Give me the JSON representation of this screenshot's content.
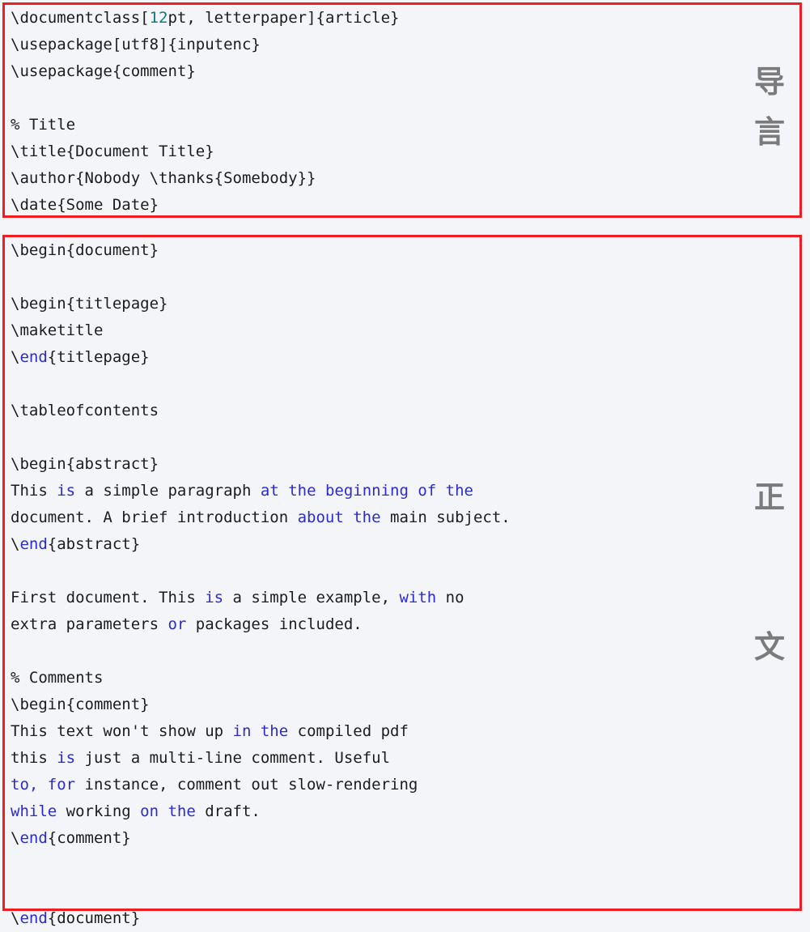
{
  "theme": {
    "background": "#f4f5f8",
    "border_color": "#ee1c23",
    "text_color": "#1c1c1c",
    "keyword_color": "#2b2bd0",
    "number_color": "#0e7b7b",
    "marker_color": "#7b7b7b"
  },
  "preamble_block": {
    "label": "latex-preamble-code-block",
    "markers": [
      {
        "name": "marker-dao",
        "text": "导"
      },
      {
        "name": "marker-yan",
        "text": "言"
      }
    ],
    "lines": [
      [
        {
          "t": "\\documentclass[",
          "k": "plain"
        },
        {
          "t": "12",
          "k": "num"
        },
        {
          "t": "pt, letterpaper]{article}",
          "k": "plain"
        }
      ],
      [
        {
          "t": "\\usepackage[utf8]{inputenc}",
          "k": "plain"
        }
      ],
      [
        {
          "t": "\\usepackage{comment}",
          "k": "plain"
        }
      ],
      [
        {
          "t": "",
          "k": "plain"
        }
      ],
      [
        {
          "t": "% Title",
          "k": "plain"
        }
      ],
      [
        {
          "t": "\\title{Document Title}",
          "k": "plain"
        }
      ],
      [
        {
          "t": "\\author{Nobody \\thanks{Somebody}}",
          "k": "plain"
        }
      ],
      [
        {
          "t": "\\date{Some Date}",
          "k": "plain"
        }
      ]
    ]
  },
  "body_block": {
    "label": "latex-body-code-block",
    "markers": [
      {
        "name": "marker-zheng",
        "text": "正"
      },
      {
        "name": "marker-wen",
        "text": "文"
      }
    ],
    "lines": [
      [
        {
          "t": "\\begin{document}",
          "k": "plain"
        }
      ],
      [
        {
          "t": "",
          "k": "plain"
        }
      ],
      [
        {
          "t": "\\begin{titlepage}",
          "k": "plain"
        }
      ],
      [
        {
          "t": "\\maketitle",
          "k": "plain"
        }
      ],
      [
        {
          "t": "\\",
          "k": "plain"
        },
        {
          "t": "end",
          "k": "kw"
        },
        {
          "t": "{titlepage}",
          "k": "plain"
        }
      ],
      [
        {
          "t": "",
          "k": "plain"
        }
      ],
      [
        {
          "t": "\\tableofcontents",
          "k": "plain"
        }
      ],
      [
        {
          "t": "",
          "k": "plain"
        }
      ],
      [
        {
          "t": "\\begin{abstract}",
          "k": "plain"
        }
      ],
      [
        {
          "t": "This ",
          "k": "plain"
        },
        {
          "t": "is",
          "k": "kw"
        },
        {
          "t": " a simple paragraph ",
          "k": "plain"
        },
        {
          "t": "at the beginning of the",
          "k": "kw"
        }
      ],
      [
        {
          "t": "document. A brief introduction ",
          "k": "plain"
        },
        {
          "t": "about the",
          "k": "kw"
        },
        {
          "t": " main subject.",
          "k": "plain"
        }
      ],
      [
        {
          "t": "\\",
          "k": "plain"
        },
        {
          "t": "end",
          "k": "kw"
        },
        {
          "t": "{abstract}",
          "k": "plain"
        }
      ],
      [
        {
          "t": "",
          "k": "plain"
        }
      ],
      [
        {
          "t": "First document. This ",
          "k": "plain"
        },
        {
          "t": "is",
          "k": "kw"
        },
        {
          "t": " a simple example, ",
          "k": "plain"
        },
        {
          "t": "with",
          "k": "kw"
        },
        {
          "t": " no",
          "k": "plain"
        }
      ],
      [
        {
          "t": "extra parameters ",
          "k": "plain"
        },
        {
          "t": "or",
          "k": "kw"
        },
        {
          "t": " packages included.",
          "k": "plain"
        }
      ],
      [
        {
          "t": "",
          "k": "plain"
        }
      ],
      [
        {
          "t": "% Comments",
          "k": "plain"
        }
      ],
      [
        {
          "t": "\\begin{comment}",
          "k": "plain"
        }
      ],
      [
        {
          "t": "This text won't show up ",
          "k": "plain"
        },
        {
          "t": "in the",
          "k": "kw"
        },
        {
          "t": " compiled pdf",
          "k": "plain"
        }
      ],
      [
        {
          "t": "this ",
          "k": "plain"
        },
        {
          "t": "is",
          "k": "kw"
        },
        {
          "t": " just a multi-line comment. Useful",
          "k": "plain"
        }
      ],
      [
        {
          "t": "to, for",
          "k": "kw"
        },
        {
          "t": " instance, comment out slow-rendering",
          "k": "plain"
        }
      ],
      [
        {
          "t": "while",
          "k": "kw"
        },
        {
          "t": " working ",
          "k": "plain"
        },
        {
          "t": "on the",
          "k": "kw"
        },
        {
          "t": " draft.",
          "k": "plain"
        }
      ],
      [
        {
          "t": "\\",
          "k": "plain"
        },
        {
          "t": "end",
          "k": "kw"
        },
        {
          "t": "{comment}",
          "k": "plain"
        }
      ],
      [
        {
          "t": "",
          "k": "plain"
        }
      ],
      [
        {
          "t": "",
          "k": "plain"
        }
      ],
      [
        {
          "t": "\\",
          "k": "plain"
        },
        {
          "t": "end",
          "k": "kw"
        },
        {
          "t": "{document}",
          "k": "plain"
        }
      ]
    ]
  }
}
